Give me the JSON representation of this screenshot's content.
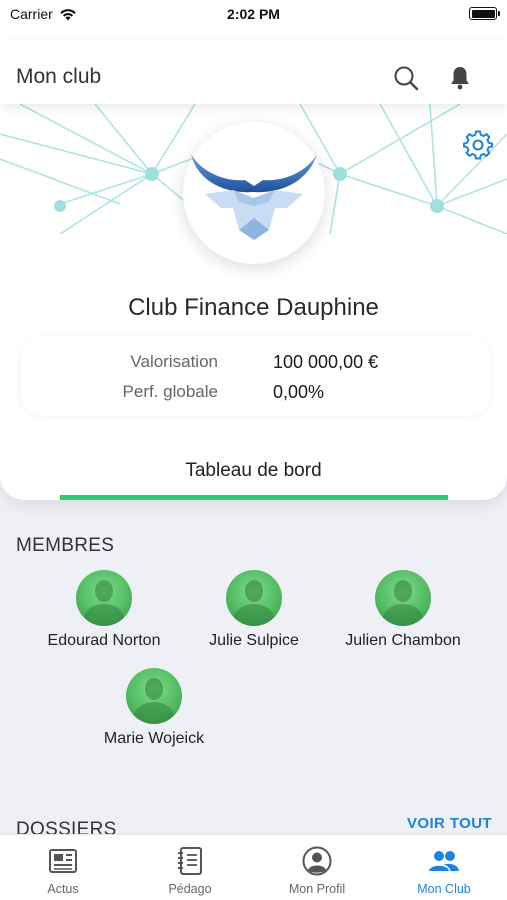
{
  "status_bar": {
    "carrier": "Carrier",
    "time": "2:02 PM"
  },
  "navbar": {
    "title": "Mon club",
    "icons": [
      "search-icon",
      "bell-icon"
    ]
  },
  "header": {
    "club_name": "Club Finance Dauphine",
    "settings_icon": "gear-icon",
    "stats": [
      {
        "label": "Valorisation",
        "value": "100 000,00 €"
      },
      {
        "label": "Perf. globale",
        "value": "0,00%"
      }
    ],
    "tab": "Tableau de bord"
  },
  "members": {
    "title": "MEMBRES",
    "items": [
      {
        "name": "Edourad Norton"
      },
      {
        "name": "Julie Sulpice"
      },
      {
        "name": "Julien Chambon"
      },
      {
        "name": "Marie Wojeick"
      }
    ]
  },
  "dossiers": {
    "title": "DOSSIERS",
    "see_all": "VOIR TOUT"
  },
  "tabbar": {
    "items": [
      {
        "label": "Actus",
        "icon": "newspaper-icon"
      },
      {
        "label": "Pédago",
        "icon": "notebook-icon"
      },
      {
        "label": "Mon Profil",
        "icon": "profile-icon"
      },
      {
        "label": "Mon Club",
        "icon": "group-icon"
      }
    ],
    "active": "Mon Club"
  },
  "colors": {
    "accent": "#1e82e0",
    "tab_underline": "#2ecc71",
    "background": "#eef0f5"
  }
}
